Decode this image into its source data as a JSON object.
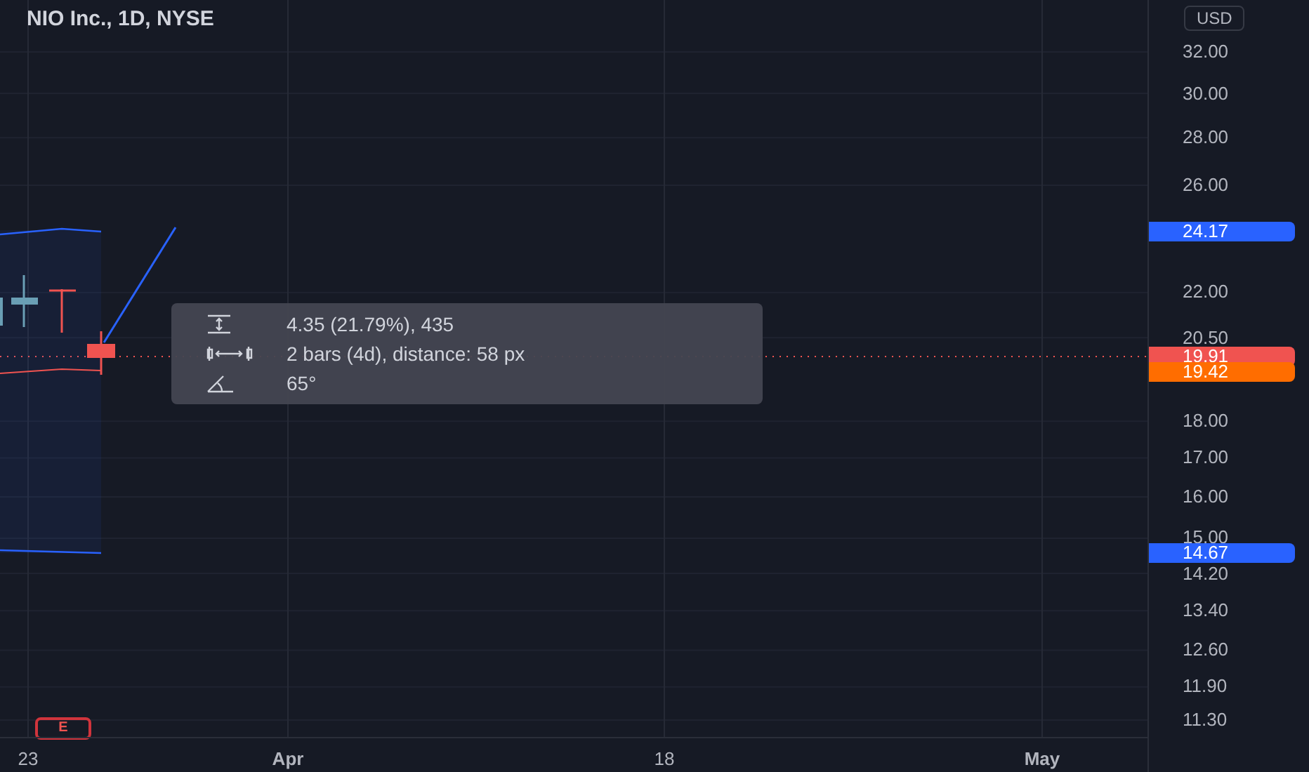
{
  "title": "NIO Inc., 1D, NYSE",
  "currency": "USD",
  "price_labels": [
    "32.00",
    "30.00",
    "28.00",
    "26.00",
    "22.00",
    "20.50",
    "18.00",
    "17.00",
    "16.00",
    "15.00",
    "14.20",
    "13.40",
    "12.60",
    "11.90",
    "11.30"
  ],
  "price_badges": [
    {
      "value": "24.17",
      "color": "#2962ff"
    },
    {
      "value": "19.91",
      "color": "#f05350"
    },
    {
      "value": "19.42",
      "color": "#ff6d00"
    },
    {
      "value": "14.67",
      "color": "#2962ff"
    }
  ],
  "measure_tooltip": [
    {
      "kind": "price",
      "text": "4.35 (21.79%), 435"
    },
    {
      "kind": "bars",
      "text": "2 bars (4d), distance: 58 px"
    },
    {
      "kind": "angle",
      "text": "65°"
    }
  ],
  "earnings_marker": "E",
  "time_labels": [
    "23",
    "Apr",
    "18",
    "May"
  ]
}
